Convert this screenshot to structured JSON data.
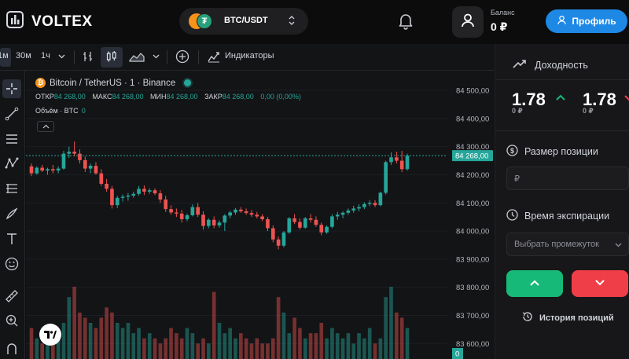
{
  "header": {
    "logo": "VOLTEX",
    "pair": "BTC/USDT",
    "balance_label": "Баланс",
    "balance_value": "0 ₽",
    "profile_button": "Профиль"
  },
  "toolbar": {
    "interval_partial": "1м",
    "interval_30m": "30м",
    "interval_1h": "1ч",
    "indicators": "Индикаторы"
  },
  "legend": {
    "symbol": "Bitcoin / TetherUS · 1 · Binance",
    "open_label": "ОТКР",
    "open_value": "84 268,00",
    "high_label": "МАКС",
    "high_value": "84 268,00",
    "low_label": "МИН",
    "low_value": "84 268,00",
    "close_label": "ЗАКР",
    "close_value": "84 268,00",
    "change": "0,00 (0,00%)",
    "volume_label": "Объём · BTC",
    "volume_value": "0"
  },
  "chart_data": {
    "type": "candlestick",
    "price_axis_labels": [
      "84 500,00",
      "84 400,00",
      "84 300,00",
      "84 200,00",
      "84 100,00",
      "84 000,00",
      "83 900,00",
      "83 800,00",
      "83 700,00",
      "83 600,00"
    ],
    "last_price": "84 268,00",
    "volume_last": "0",
    "ylim": [
      83545,
      84570
    ],
    "colors": {
      "up": "#26a69a",
      "down": "#ef5350"
    },
    "candles": [
      [
        84230,
        84240,
        84195,
        84205
      ],
      [
        84205,
        84230,
        84200,
        84225
      ],
      [
        84225,
        84235,
        84210,
        84215
      ],
      [
        84215,
        84225,
        84200,
        84220
      ],
      [
        84220,
        84235,
        84205,
        84215
      ],
      [
        84215,
        84230,
        84205,
        84222
      ],
      [
        84222,
        84285,
        84218,
        84275
      ],
      [
        84275,
        84300,
        84260,
        84282
      ],
      [
        84282,
        84318,
        84265,
        84275
      ],
      [
        84275,
        84290,
        84240,
        84252
      ],
      [
        84252,
        84265,
        84210,
        84222
      ],
      [
        84222,
        84240,
        84205,
        84232
      ],
      [
        84232,
        84245,
        84200,
        84205
      ],
      [
        84205,
        84220,
        84160,
        84168
      ],
      [
        84168,
        84185,
        84140,
        84150
      ],
      [
        84150,
        84160,
        84080,
        84092
      ],
      [
        84092,
        84125,
        84082,
        84118
      ],
      [
        84118,
        84130,
        84105,
        84122
      ],
      [
        84122,
        84135,
        84108,
        84126
      ],
      [
        84126,
        84140,
        84118,
        84132
      ],
      [
        84132,
        84160,
        84125,
        84150
      ],
      [
        84150,
        84162,
        84128,
        84140
      ],
      [
        84140,
        84152,
        84132,
        84145
      ],
      [
        84145,
        84152,
        84128,
        84134
      ],
      [
        84134,
        84145,
        84100,
        84112
      ],
      [
        84112,
        84125,
        84068,
        84078
      ],
      [
        84078,
        84092,
        84058,
        84066
      ],
      [
        84066,
        84080,
        84050,
        84062
      ],
      [
        84062,
        84075,
        84030,
        84042
      ],
      [
        84042,
        84062,
        84035,
        84056
      ],
      [
        84056,
        84095,
        84052,
        84085
      ],
      [
        84085,
        84100,
        84050,
        84058
      ],
      [
        84058,
        84070,
        84005,
        84018
      ],
      [
        84018,
        84045,
        84010,
        84040
      ],
      [
        84040,
        84052,
        84010,
        84020
      ],
      [
        84020,
        84038,
        84012,
        84030
      ],
      [
        84030,
        84060,
        84000,
        84055
      ],
      [
        84055,
        84072,
        84045,
        84066
      ],
      [
        84066,
        84082,
        84058,
        84076
      ],
      [
        84076,
        84085,
        84065,
        84070
      ],
      [
        84070,
        84080,
        84058,
        84064
      ],
      [
        84064,
        84075,
        84050,
        84058
      ],
      [
        84058,
        84068,
        84045,
        84052
      ],
      [
        84052,
        84060,
        84035,
        84042
      ],
      [
        84042,
        84050,
        84000,
        84010
      ],
      [
        84010,
        84020,
        83960,
        83970
      ],
      [
        83970,
        83980,
        83935,
        83948
      ],
      [
        83948,
        84000,
        83942,
        83995
      ],
      [
        83995,
        84050,
        83990,
        84045
      ],
      [
        84045,
        84060,
        84025,
        84032
      ],
      [
        84032,
        84045,
        84005,
        84012
      ],
      [
        84012,
        84050,
        84008,
        84045
      ],
      [
        84045,
        84060,
        84030,
        84040
      ],
      [
        84040,
        84052,
        84015,
        84022
      ],
      [
        84022,
        84030,
        83985,
        83995
      ],
      [
        83995,
        84020,
        83990,
        84015
      ],
      [
        84015,
        84060,
        84010,
        84052
      ],
      [
        84052,
        84068,
        84040,
        84058
      ],
      [
        84058,
        84070,
        84045,
        84065
      ],
      [
        84065,
        84080,
        84058,
        84073
      ],
      [
        84073,
        84090,
        84065,
        84080
      ],
      [
        84080,
        84095,
        84070,
        84085
      ],
      [
        84085,
        84102,
        84078,
        84096
      ],
      [
        84096,
        84110,
        84088,
        84100
      ],
      [
        84100,
        84110,
        84085,
        84092
      ],
      [
        84092,
        84140,
        84088,
        84136
      ],
      [
        84136,
        84250,
        84130,
        84245
      ],
      [
        84245,
        84280,
        84235,
        84262
      ],
      [
        84262,
        84282,
        84240,
        84250
      ],
      [
        84250,
        84285,
        84210,
        84220
      ],
      [
        84220,
        84275,
        84215,
        84268
      ]
    ],
    "volumes": [
      6,
      4,
      3,
      4,
      3,
      5,
      7,
      12,
      14,
      9,
      8,
      7,
      6,
      8,
      10,
      9,
      7,
      6,
      7,
      5,
      6,
      4,
      5,
      4,
      3,
      4,
      6,
      5,
      4,
      6,
      5,
      3,
      4,
      3,
      13,
      7,
      5,
      6,
      4,
      5,
      4,
      3,
      4,
      3,
      3,
      4,
      12,
      9,
      5,
      8,
      6,
      4,
      5,
      5,
      7,
      4,
      6,
      5,
      4,
      5,
      3,
      5,
      4,
      6,
      3,
      4,
      12,
      14,
      9,
      8,
      6
    ]
  },
  "right_panel": {
    "payout_title": "Доходность",
    "payout_up_value": "1.78",
    "payout_up_currency": "0 ₽",
    "payout_down_value": "1.78",
    "payout_down_currency": "0 ₽",
    "size_label": "Размер позиции",
    "size_placeholder": "₽",
    "expiry_label": "Время экспирации",
    "expiry_placeholder": "Выбрать промежуток",
    "history": "История позиций"
  }
}
